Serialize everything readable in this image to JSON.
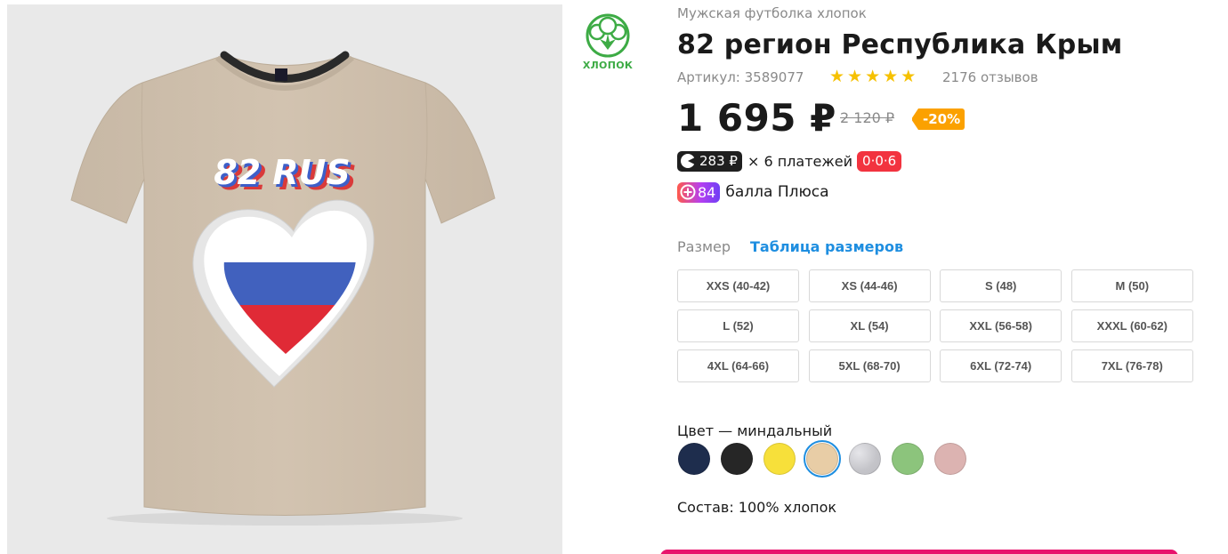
{
  "product": {
    "category": "Мужская футболка хлопок",
    "title": "82 регион Республика Крым",
    "sku": "Артикул: 3589077",
    "rating_stars": 5,
    "reviews": "2176 отзывов",
    "print_text": "82 RUS"
  },
  "badge": {
    "icon": "cotton-icon",
    "label": "ХЛОПОК"
  },
  "pricing": {
    "price": "1 695 ₽",
    "old_price": "2 120 ₽",
    "discount": "-20%"
  },
  "installments": {
    "amount": "283 ₽",
    "text": "× 6 платежей",
    "badge": "0·0·6"
  },
  "plus": {
    "points": "84",
    "text": "балла Плюса"
  },
  "size_section": {
    "label": "Размер",
    "table_link": "Таблица размеров",
    "sizes": [
      "XXS (40-42)",
      "XS (44-46)",
      "S (48)",
      "M (50)",
      "L (52)",
      "XL (54)",
      "XXL (56-58)",
      "XXXL (60-62)",
      "4XL (64-66)",
      "5XL (68-70)",
      "6XL (72-74)",
      "7XL (76-78)"
    ]
  },
  "color_section": {
    "label": "Цвет — миндальный",
    "swatches": [
      {
        "color": "#1e2d4d",
        "selected": false
      },
      {
        "color": "#262626",
        "selected": false
      },
      {
        "color": "#f7e03a",
        "selected": false
      },
      {
        "color": "#e8cda6",
        "selected": true
      },
      {
        "color": "#cfcfd3",
        "selected": false
      },
      {
        "color": "#8cc47c",
        "selected": false
      },
      {
        "color": "#dcb3b1",
        "selected": false
      }
    ]
  },
  "composition": "Состав: 100% хлопок",
  "colors": {
    "accent_blue": "#1e8ee0",
    "discount_orange": "#fba100",
    "split_red": "#f2333f",
    "buy_pink": "#e8146c",
    "star": "#f6c100"
  }
}
